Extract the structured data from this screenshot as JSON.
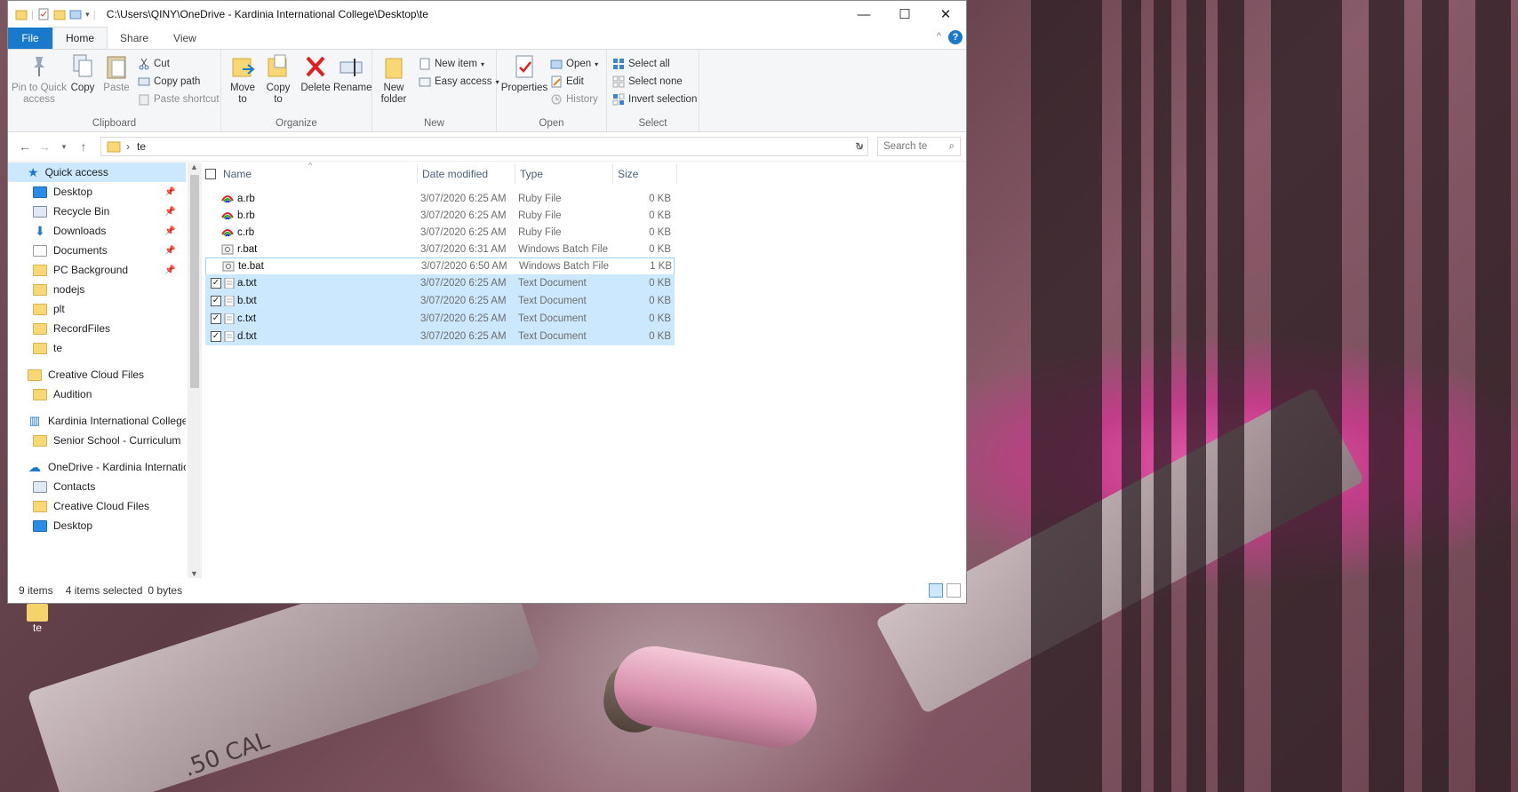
{
  "window": {
    "title_path": "C:\\Users\\QINY\\OneDrive - Kardinia International College\\Desktop\\te",
    "controls": {
      "minimize": "—",
      "maximize": "☐",
      "close": "✕"
    }
  },
  "tabs": {
    "file": "File",
    "home": "Home",
    "share": "Share",
    "view": "View",
    "help": "?"
  },
  "ribbon": {
    "clipboard": {
      "label": "Clipboard",
      "pin": "Pin to Quick access",
      "copy": "Copy",
      "paste": "Paste",
      "cut": "Cut",
      "copy_path": "Copy path",
      "paste_shortcut": "Paste shortcut"
    },
    "organize": {
      "label": "Organize",
      "move_to": "Move to",
      "copy_to": "Copy to",
      "delete": "Delete",
      "rename": "Rename"
    },
    "new": {
      "label": "New",
      "new_folder": "New folder",
      "new_item": "New item",
      "easy_access": "Easy access"
    },
    "open": {
      "label": "Open",
      "properties": "Properties",
      "open": "Open",
      "edit": "Edit",
      "history": "History"
    },
    "select": {
      "label": "Select",
      "select_all": "Select all",
      "select_none": "Select none",
      "invert": "Invert selection"
    }
  },
  "address": {
    "crumb": "te",
    "search_placeholder": "Search te"
  },
  "nav": {
    "quick_access": "Quick access",
    "items": [
      {
        "label": "Desktop",
        "pinned": true
      },
      {
        "label": "Recycle Bin",
        "pinned": true
      },
      {
        "label": "Downloads",
        "pinned": true
      },
      {
        "label": "Documents",
        "pinned": true
      },
      {
        "label": "PC Background",
        "pinned": true
      },
      {
        "label": "nodejs",
        "pinned": false
      },
      {
        "label": "plt",
        "pinned": false
      },
      {
        "label": "RecordFiles",
        "pinned": false
      },
      {
        "label": "te",
        "pinned": false
      }
    ],
    "creative_cloud": "Creative Cloud Files",
    "audition": "Audition",
    "kardinia": "Kardinia International College",
    "senior": "Senior School - Curriculum",
    "onedrive": "OneDrive - Kardinia Internatio",
    "contacts": "Contacts",
    "cc_files": "Creative Cloud Files",
    "desktop2": "Desktop"
  },
  "columns": {
    "name": "Name",
    "date": "Date modified",
    "type": "Type",
    "size": "Size"
  },
  "files": [
    {
      "name": "a.rb",
      "date": "3/07/2020 6:25 AM",
      "type": "Ruby File",
      "size": "0 KB",
      "selected": false
    },
    {
      "name": "b.rb",
      "date": "3/07/2020 6:25 AM",
      "type": "Ruby File",
      "size": "0 KB",
      "selected": false
    },
    {
      "name": "c.rb",
      "date": "3/07/2020 6:25 AM",
      "type": "Ruby File",
      "size": "0 KB",
      "selected": false
    },
    {
      "name": "r.bat",
      "date": "3/07/2020 6:31 AM",
      "type": "Windows Batch File",
      "size": "0 KB",
      "selected": false
    },
    {
      "name": "te.bat",
      "date": "3/07/2020 6:50 AM",
      "type": "Windows Batch File",
      "size": "1 KB",
      "selected": false
    },
    {
      "name": "a.txt",
      "date": "3/07/2020 6:25 AM",
      "type": "Text Document",
      "size": "0 KB",
      "selected": true
    },
    {
      "name": "b.txt",
      "date": "3/07/2020 6:25 AM",
      "type": "Text Document",
      "size": "0 KB",
      "selected": true
    },
    {
      "name": "c.txt",
      "date": "3/07/2020 6:25 AM",
      "type": "Text Document",
      "size": "0 KB",
      "selected": true
    },
    {
      "name": "d.txt",
      "date": "3/07/2020 6:25 AM",
      "type": "Text Document",
      "size": "0 KB",
      "selected": true
    }
  ],
  "status": {
    "count": "9 items",
    "selected": "4 items selected",
    "bytes": "0 bytes"
  },
  "desktop": {
    "icon_label": "te",
    "cal_text": ".50 CAL"
  },
  "colors": {
    "accent": "#1979ca",
    "selection": "#cce8ff",
    "folder": "#f8d775"
  }
}
